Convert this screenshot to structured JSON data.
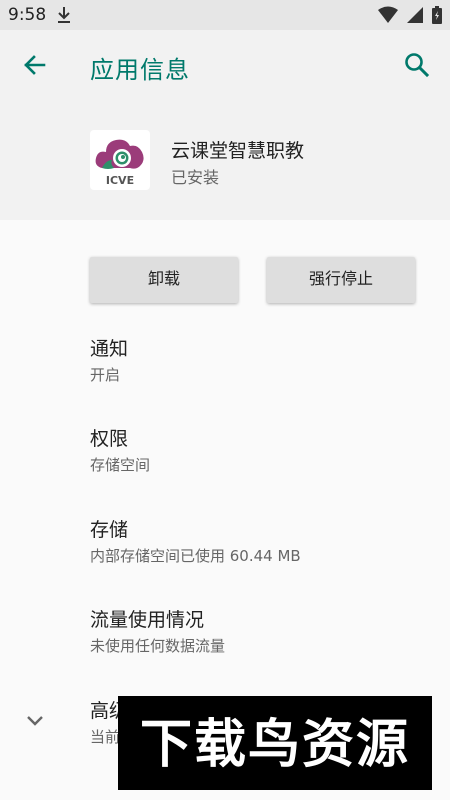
{
  "status_bar": {
    "time": "9:58",
    "icons": [
      "download-icon",
      "wifi-icon",
      "signal-icon",
      "battery-icon"
    ]
  },
  "app_bar": {
    "title": "应用信息",
    "back_icon": "arrow-back-icon",
    "search_icon": "search-icon"
  },
  "app": {
    "name": "云课堂智慧职教",
    "install_status": "已安装",
    "logo_text": "ICVE"
  },
  "actions": {
    "uninstall_label": "卸载",
    "force_stop_label": "强行停止"
  },
  "settings": [
    {
      "title": "通知",
      "subtitle": "开启"
    },
    {
      "title": "权限",
      "subtitle": "存储空间"
    },
    {
      "title": "存储",
      "subtitle": "内部存储空间已使用 60.44 MB"
    },
    {
      "title": "流量使用情况",
      "subtitle": "未使用任何数据流量"
    },
    {
      "title": "高级",
      "subtitle": "当前"
    }
  ],
  "watermark": {
    "text": "下载鸟资源"
  },
  "colors": {
    "accent": "#00796b",
    "status_bar_bg": "#e6e6e6",
    "header_bg": "#f2f2f2",
    "page_bg": "#fafafa",
    "button_bg": "#dedede"
  }
}
